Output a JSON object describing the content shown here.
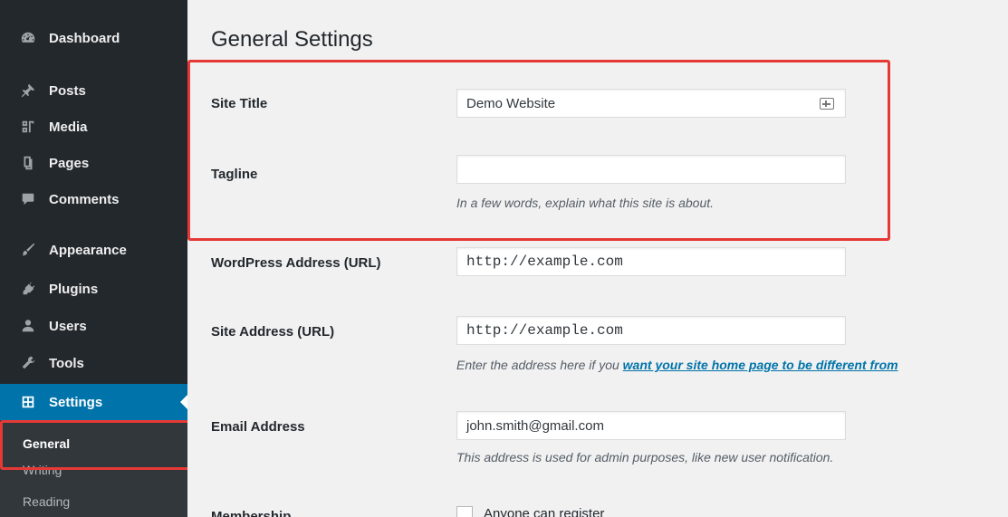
{
  "sidebar": {
    "items": [
      {
        "label": "Dashboard",
        "icon": "dashboard-icon"
      },
      {
        "label": "Posts",
        "icon": "pin-icon"
      },
      {
        "label": "Media",
        "icon": "media-icon"
      },
      {
        "label": "Pages",
        "icon": "pages-icon"
      },
      {
        "label": "Comments",
        "icon": "comment-icon"
      },
      {
        "label": "Appearance",
        "icon": "brush-icon"
      },
      {
        "label": "Plugins",
        "icon": "plug-icon"
      },
      {
        "label": "Users",
        "icon": "user-icon"
      },
      {
        "label": "Tools",
        "icon": "wrench-icon"
      },
      {
        "label": "Settings",
        "icon": "settings-icon",
        "active": true
      }
    ],
    "submenu": [
      {
        "label": "General",
        "current": true
      },
      {
        "label": "Writing"
      },
      {
        "label": "Reading"
      }
    ]
  },
  "main": {
    "title": "General Settings",
    "fields": {
      "site_title": {
        "label": "Site Title",
        "value": "Demo Website"
      },
      "tagline": {
        "label": "Tagline",
        "value": "",
        "description": "In a few words, explain what this site is about."
      },
      "wp_address": {
        "label": "WordPress Address (URL)",
        "value": "http://example.com"
      },
      "site_address": {
        "label": "Site Address (URL)",
        "value": "http://example.com",
        "description_prefix": "Enter the address here if you ",
        "description_link": "want your site home page to be different from"
      },
      "email": {
        "label": "Email Address",
        "value": "john.smith@gmail.com",
        "description": "This address is used for admin purposes, like new user notification."
      },
      "membership": {
        "label": "Membership",
        "checkbox_label": "Anyone can register"
      }
    }
  },
  "colors": {
    "sidebar_bg": "#23282d",
    "active_bg": "#0073aa",
    "highlight": "#e53935",
    "link": "#0073aa"
  }
}
